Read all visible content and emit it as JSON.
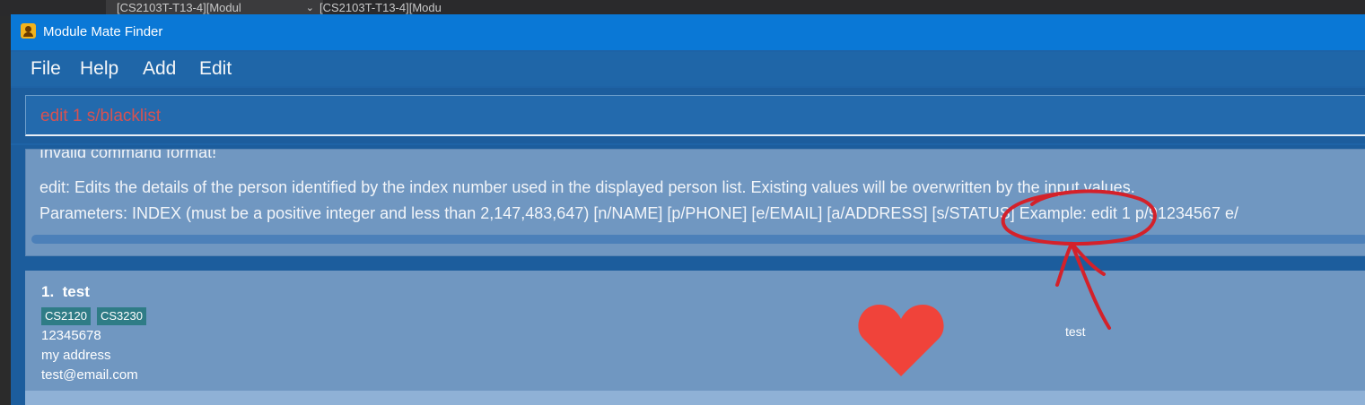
{
  "browser_tabs": [
    {
      "label": "[CS2103T-T13-4][Modul"
    },
    {
      "label": "[CS2103T-T13-4][Modu"
    }
  ],
  "window": {
    "title": "Module Mate Finder"
  },
  "menu": [
    "File",
    "Help",
    "Add",
    "Edit"
  ],
  "command_box": {
    "value": "edit 1 s/blacklist",
    "text_color": "#d65252"
  },
  "result": {
    "lines": [
      "Invalid command format!",
      "edit: Edits the details of the person identified by the index number used in the displayed person list. Existing values will be overwritten by the input values.",
      "Parameters: INDEX (must be a positive integer and less than 2,147,483,647) [n/NAME] [p/PHONE] [e/EMAIL] [a/ADDRESS] [s/STATUS] Example: edit 1 p/91234567 e/"
    ]
  },
  "person_list": [
    {
      "index": "1.",
      "name": "test",
      "tags": [
        "CS2120",
        "CS3230"
      ],
      "phone": "12345678",
      "address": "my address",
      "email": "test@email.com",
      "status_icon": "heart-icon",
      "status_label": "test"
    }
  ],
  "colors": {
    "titlebar": "#0a78d6",
    "window_bg": "#1e63a6",
    "card_bg": "#7097c1",
    "tag_bg": "#2f7c86",
    "heart": "#f0433a",
    "annotation": "#d4212a"
  }
}
